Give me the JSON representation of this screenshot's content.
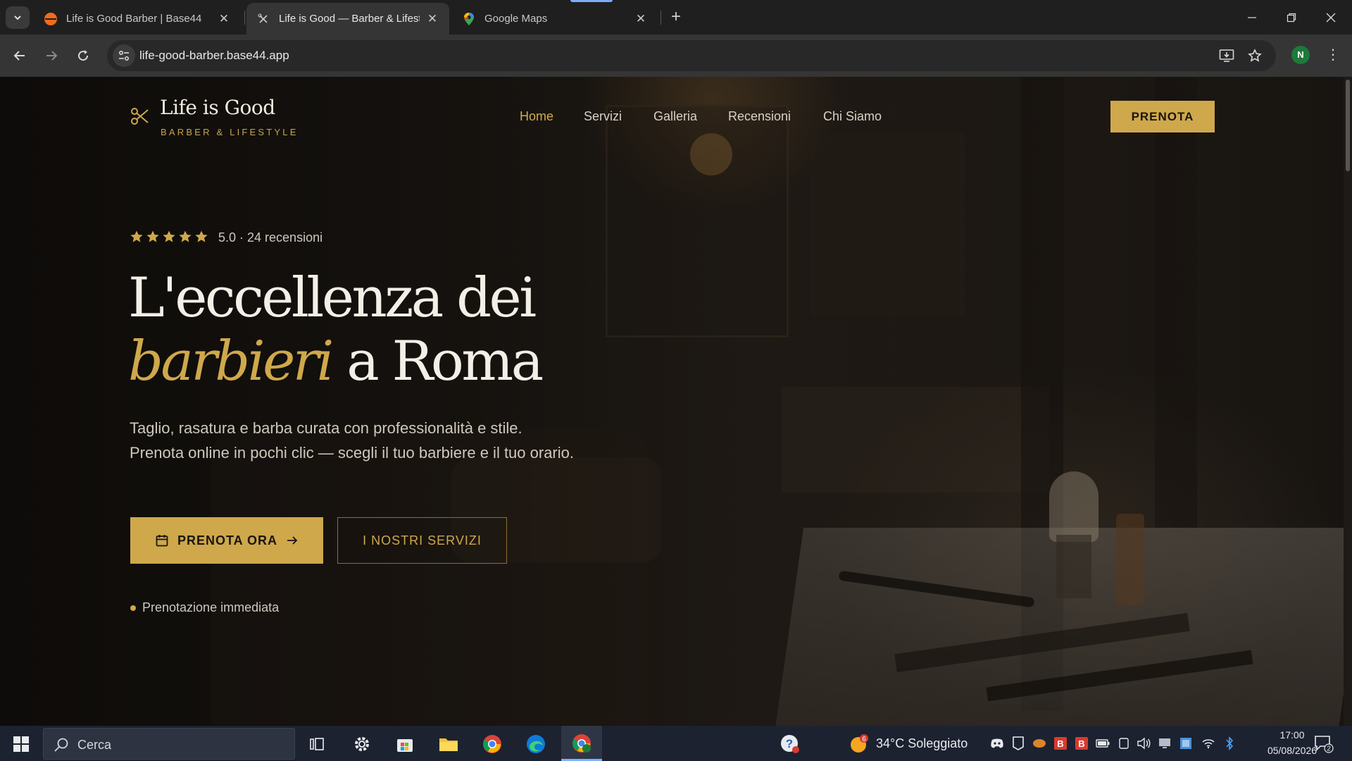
{
  "browser": {
    "tabs": [
      {
        "title": "Life is Good Barber | Base44",
        "icon": "base44-orange-dot-icon",
        "active": false
      },
      {
        "title": "Life is Good — Barber & Lifestyle",
        "icon": "scissors-favicon-icon",
        "active": true
      },
      {
        "title": "Google Maps",
        "icon": "google-maps-pin-icon",
        "active": false
      }
    ],
    "url": "life-good-barber.base44.app",
    "profile_initial": "N",
    "icons": {
      "back": "arrow-left-icon",
      "forward": "arrow-right-icon",
      "reload": "reload-icon",
      "site_info": "tune-icon",
      "install": "install-app-icon",
      "bookmark": "star-outline-icon",
      "menu": "kebab-menu-icon"
    }
  },
  "site": {
    "brand": {
      "title": "Life is Good",
      "subtitle": "BARBER & LIFESTYLE",
      "icon": "scissors-icon"
    },
    "nav": [
      {
        "label": "Home",
        "active": true
      },
      {
        "label": "Servizi",
        "active": false
      },
      {
        "label": "Galleria",
        "active": false
      },
      {
        "label": "Recensioni",
        "active": false
      },
      {
        "label": "Chi Siamo",
        "active": false
      }
    ],
    "cta_top": "PRENOTA",
    "hero": {
      "rating_stars": 5,
      "rating_text": "5.0 · 24 recensioni",
      "headline_line1": "L'eccellenza dei",
      "headline_emphasis": "barbieri",
      "headline_line2_rest": " a Roma",
      "lead": "Taglio, rasatura e barba curata con professionalità e stile. Prenota online in pochi clic — scegli il tuo barbiere e il tuo orario.",
      "primary_button": "PRENOTA ORA",
      "secondary_button": "I NOSTRI SERVIZI",
      "feature": "Prenotazione immediata"
    },
    "colors": {
      "accent": "#cfa84c",
      "background": "#1b1713",
      "text_light": "#f4efe6"
    }
  },
  "taskbar": {
    "search_placeholder": "Cerca",
    "weather": "34°C Soleggiato",
    "weather_badge": "6",
    "time": "17:00",
    "date": "05/08/2026",
    "notifications": "2",
    "apps": [
      "windows-start-icon",
      "task-view-icon",
      "settings-icon",
      "microsoft-store-icon",
      "file-explorer-icon",
      "chrome-icon",
      "edge-icon",
      "chrome-profile-icon"
    ]
  }
}
